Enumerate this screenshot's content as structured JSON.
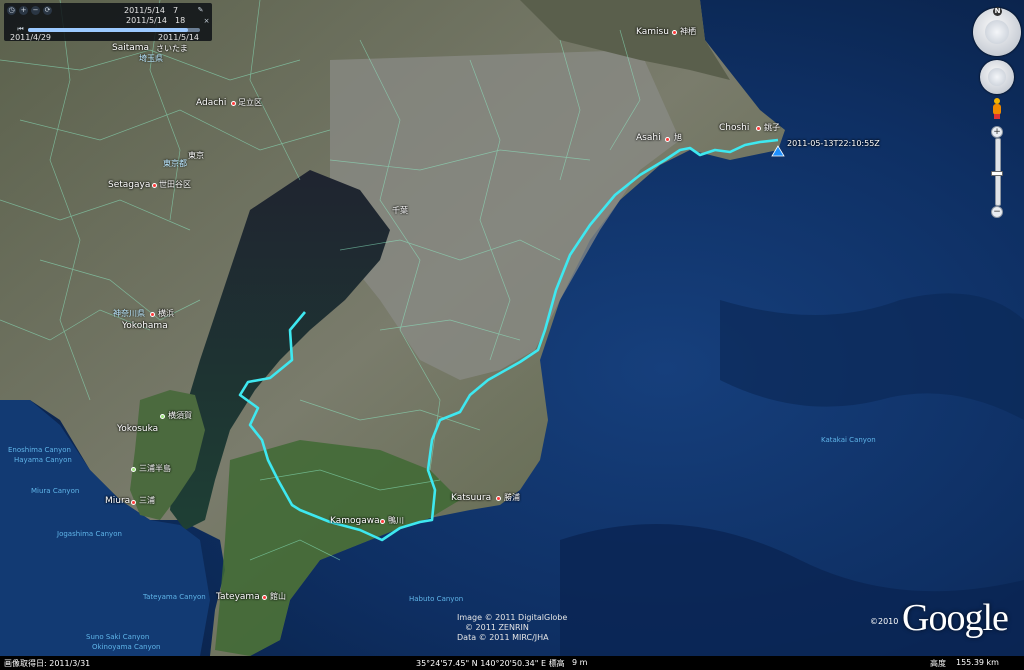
{
  "time_slider": {
    "start_label": "2011/4/29",
    "end_label": "2011/5/14",
    "current_line1": "2011/5/14　7",
    "current_line2": "2011/5/14　18",
    "position": 0.93
  },
  "track_label": "2011-05-13T22:10:55Z",
  "places": [
    {
      "name": "Saitama",
      "jp": "さいたま",
      "key": "saitama"
    },
    {
      "name": "Adachi",
      "jp": "足立区",
      "key": "adachi"
    },
    {
      "name": "Setagaya",
      "jp": "世田谷区",
      "key": "setagaya"
    },
    {
      "name": "Yokohama",
      "jp": "横浜",
      "key": "yokohama"
    },
    {
      "name": "Yokosuka",
      "jp": "横須賀",
      "key": "yokosuka"
    },
    {
      "name": "Miura",
      "jp": "三浦",
      "key": "miura"
    },
    {
      "name": "Tateyama",
      "jp": "館山",
      "key": "tateyama"
    },
    {
      "name": "Kamogawa",
      "jp": "鴨川",
      "key": "kamogawa"
    },
    {
      "name": "Katsuura",
      "jp": "勝浦",
      "key": "katsuura"
    },
    {
      "name": "Asahi",
      "jp": "旭",
      "key": "asahi"
    },
    {
      "name": "Choshi",
      "jp": "銚子",
      "key": "choshi"
    },
    {
      "name": "Kamisu",
      "jp": "神栖",
      "key": "kamisu"
    }
  ],
  "jp_labels": {
    "saitama_pref": "埼玉県",
    "tokyo": "東京",
    "tokyo_to": "東京都",
    "kanagawa": "神奈川県",
    "miura_hanto": "三浦半島",
    "chiba": "千葉"
  },
  "sea_labels": {
    "enoshima": "Enoshima Canyon",
    "hayama": "Hayama Canyon",
    "miura": "Miura Canyon",
    "jogashima": "Jogashima Canyon",
    "tateyama": "Tateyama Canyon",
    "sunosaki": "Suno Saki Canyon",
    "okinoyama": "Okinoyama Canyon",
    "habuto": "Habuto Canyon",
    "katakai": "Katakai Canyon"
  },
  "attribution": {
    "line1": "Image © 2011 DigitalGlobe",
    "line2": "© 2011 ZENRIN",
    "line3": "Data © 2011 MIRC/JHA"
  },
  "google": {
    "year": "©2010",
    "logo": "Google"
  },
  "status_bar": {
    "imagery_date": "画像取得日: 2011/3/31",
    "coordinates": "35°24'57.45\" N  140°20'50.34\" E  標高",
    "elevation": "9 m",
    "altitude_label": "高度",
    "altitude_value": "155.39 km"
  },
  "nav": {
    "north_label": "N"
  },
  "colors": {
    "track": "#3ee8f0",
    "water": "#0d3266",
    "land": "#6b6f5a"
  }
}
